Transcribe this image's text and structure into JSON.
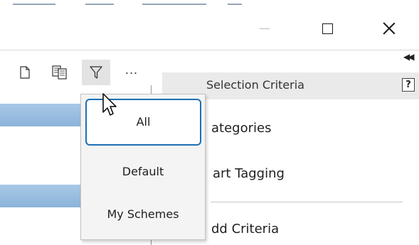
{
  "window_controls": {
    "minimize_icon": "minimize-icon",
    "maximize_icon": "maximize-icon",
    "close_icon": "close-icon"
  },
  "toolbar": {
    "buttons": [
      "new-document-icon",
      "copy-documents-icon",
      "filter-icon",
      "more-icon"
    ],
    "more_label": "...",
    "collapse_label": "◀◀"
  },
  "filter_menu": {
    "items": [
      {
        "label": "All",
        "selected": true
      },
      {
        "label": "Default",
        "selected": false
      },
      {
        "label": "My Schemes",
        "selected": false
      }
    ]
  },
  "selection_criteria": {
    "title": "Selection Criteria",
    "help_label": "?",
    "items": [
      {
        "label": "ategories"
      },
      {
        "label": "art Tagging"
      },
      {
        "label": "dd Criteria"
      }
    ]
  },
  "colors": {
    "selection_border": "#1f6fb5",
    "row_highlight": "#9dbfe0",
    "header_bg": "#eaeaea"
  }
}
